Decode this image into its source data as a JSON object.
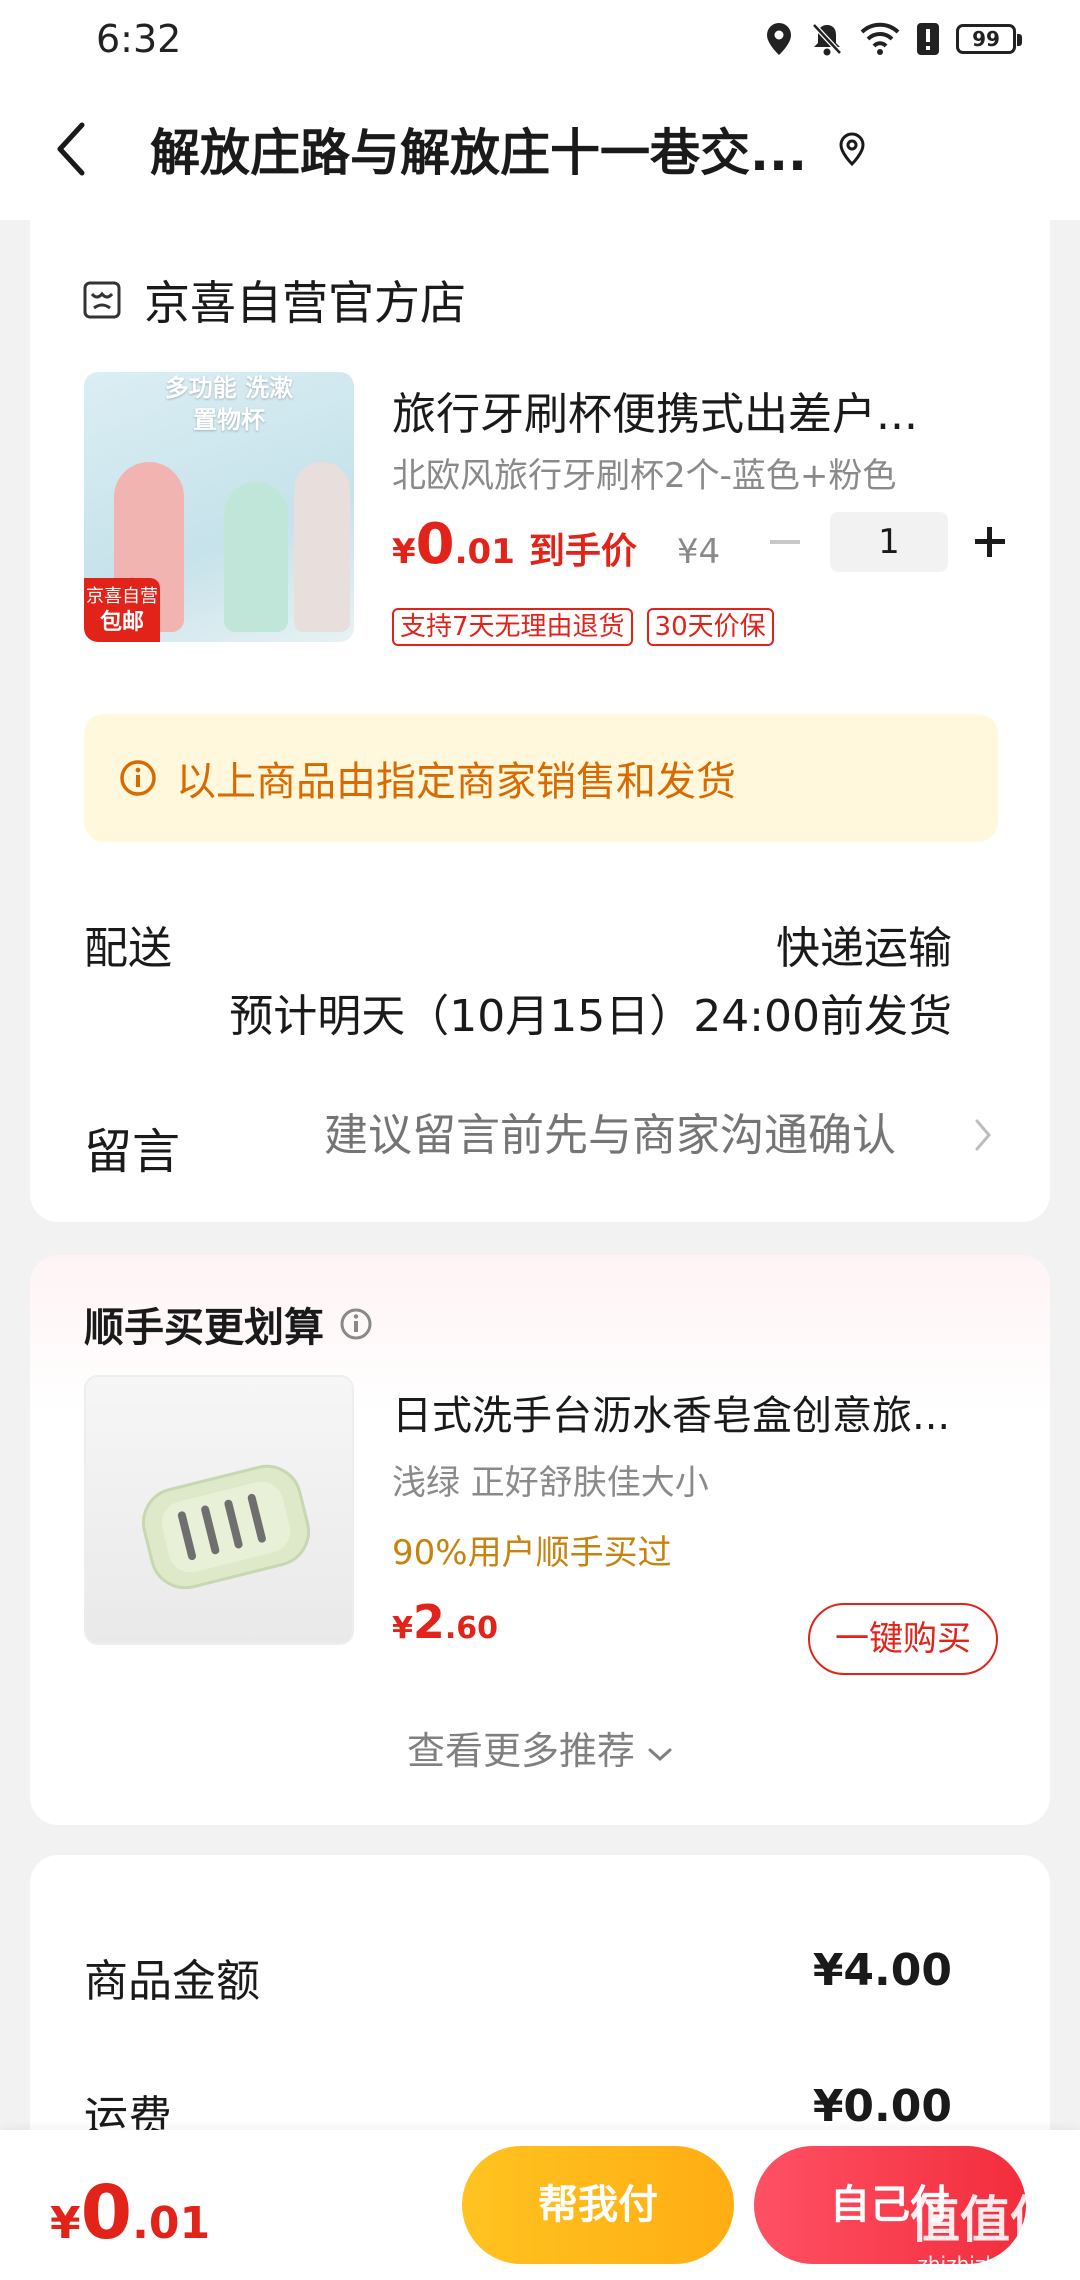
{
  "status_bar": {
    "time": "6:32",
    "battery": "99"
  },
  "header": {
    "title": "解放庄路与解放庄十一巷交..."
  },
  "store": {
    "name": "京喜自营官方店"
  },
  "product": {
    "image_text": "多功能 洗漱置物杯",
    "image_badge_top": "京喜自营",
    "image_badge_bottom": "包邮",
    "title": "旅行牙刷杯便携式出差户...",
    "spec": "北欧风旅行牙刷杯2个-蓝色+粉色",
    "price_yen": "¥",
    "price_int": "0",
    "price_dec": ".01",
    "price_label": "到手价",
    "orig_price": "¥4",
    "quantity": "1",
    "tags": [
      "支持7天无理由退货",
      "30天价保"
    ]
  },
  "notice": {
    "text": "以上商品由指定商家销售和发货"
  },
  "shipping": {
    "label": "配送",
    "method": "快递运输",
    "eta": "预计明天（10月15日）24:00前发货"
  },
  "memo": {
    "label": "留言",
    "placeholder": "建议留言前先与商家沟通确认"
  },
  "recommend": {
    "title": "顺手买更划算",
    "item": {
      "title": "日式洗手台沥水香皂盒创意旅...",
      "spec": "浅绿 正好舒肤佳大小",
      "social": "90%用户顺手买过",
      "price_yen": "¥",
      "price_int": "2",
      "price_dec": ".60",
      "buy_label": "一键购买"
    },
    "more_label": "查看更多推荐"
  },
  "summary": {
    "goods_label": "商品金额",
    "goods_value": "¥4.00",
    "freight_label": "运费",
    "freight_value": "¥0.00"
  },
  "bottom": {
    "total_yen": "¥",
    "total_int": "0",
    "total_dec": ".01",
    "help_pay": "帮我付",
    "self_pay": "自己付"
  },
  "watermark": {
    "text": "值值值",
    "url": "zhizhizhi.com"
  },
  "colors": {
    "accent": "#e2231a",
    "notice_bg": "#fff8dc",
    "notice_text": "#d96a00",
    "help_btn": "#ffb81a",
    "self_btn": "#f5303f"
  }
}
